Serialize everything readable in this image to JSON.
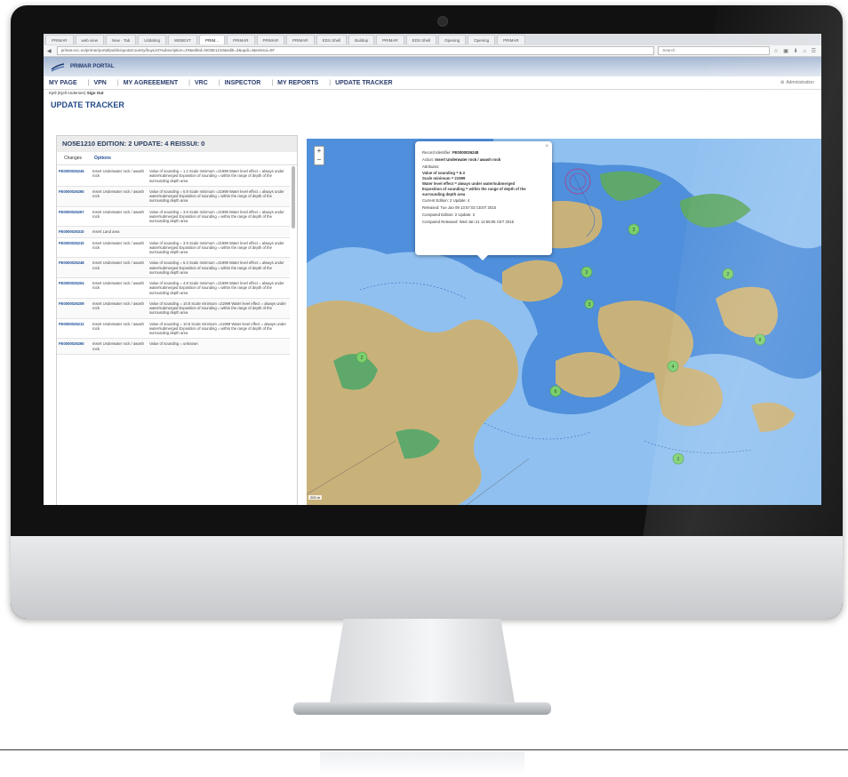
{
  "browser": {
    "tabs": [
      "PRIMAR",
      "web view",
      "New · Tab",
      "Uitdating",
      "WEBEXT",
      "PRIM...",
      "PRIMAR",
      "PRIMAR",
      "PRIMAR",
      "EDS Shell",
      "Buildup",
      "PRIMAR",
      "EDS Shell",
      "Opening",
      "Opening",
      "PRIMAR"
    ],
    "url": "primar.ecc.no/primar/portal/public/quotaCountry/buyList?subscription=2#&editId=NO5E1210&editi=2&updi=4&reissui=0#",
    "search_placeholder": "Search"
  },
  "portal": {
    "name": "PRIMAR PORTAL"
  },
  "nav": {
    "items": [
      "MY PAGE",
      "VPN",
      "MY AGREEEMENT",
      "VRC",
      "INSPECTOR",
      "MY REPORTS",
      "UPDATE TRACKER"
    ],
    "admin_label": "Administration"
  },
  "user": {
    "name": "Kjell (Kjell Andersen)",
    "signout": "Sign Out"
  },
  "page": {
    "title": "UPDATE TRACKER"
  },
  "panel": {
    "heading": "NO5E1210 EDITION: 2 UPDATE: 4 REISSUI: 0",
    "tabs": [
      "Changes",
      "Options"
    ],
    "rows": [
      {
        "id": "FE0000026245",
        "action": "Insert Underwater rock / awash rock",
        "desc": "Value of sounding = 1.2 Scale minimum =21999 Water level effect = always under water/submerged Exposition of sounding = within the range of depth of the surrounding depth area"
      },
      {
        "id": "FE0000026260",
        "action": "Insert Underwater rock / awash rock",
        "desc": "Value of sounding = 5.9 Scale minimum =21999 Water level effect = always under water/submerged Exposition of sounding = within the range of depth of the surrounding depth area"
      },
      {
        "id": "FE0000026267",
        "action": "Insert Underwater rock / awash rock",
        "desc": "Value of sounding = 3.8 Scale minimum =21999 Water level effect = always under water/submerged Exposition of sounding = within the range of depth of the surrounding depth area"
      },
      {
        "id": "FE0000026310",
        "action": "Insert Land area",
        "desc": ""
      },
      {
        "id": "FE0000026210",
        "action": "Insert Underwater rock / awash rock",
        "desc": "Value of sounding = 3.9 Scale minimum =21999 Water level effect = always under water/submerged Exposition of sounding = within the range of depth of the surrounding depth area"
      },
      {
        "id": "FE0000026248",
        "action": "Insert Underwater rock / awash rock",
        "desc": "Value of sounding = 6.3 Scale minimum =21999 Water level effect = always under water/submerged Exposition of sounding = within the range of depth of the surrounding depth area"
      },
      {
        "id": "FE0000026204",
        "action": "Insert Underwater rock / awash rock",
        "desc": "Value of sounding = 4.8 Scale minimum =21999 Water level effect = always under water/submerged Exposition of sounding = within the range of depth of the surrounding depth area"
      },
      {
        "id": "FE0000026209",
        "action": "Insert Underwater rock / awash rock",
        "desc": "Value of sounding = 10.8 Scale minimum =21999 Water level effect = always under water/submerged Exposition of sounding = within the range of depth of the surrounding depth area"
      },
      {
        "id": "FE0000026212",
        "action": "Insert Underwater rock / awash rock",
        "desc": "Value of sounding = 10.8 Scale minimum =21999 Water level effect = always under water/submerged Exposition of sounding = within the range of depth of the surrounding depth area"
      },
      {
        "id": "FE0000026260",
        "action": "Insert Underwater rock / awash rock",
        "desc": "Value of sounding = unknown"
      }
    ]
  },
  "popup": {
    "record_label": "Record Identifier:",
    "record_id": "FE0000026248",
    "action_label": "Action:",
    "action": "Insert Underwater rock / awash rock",
    "attributes_label": "Attributes:",
    "attr1": "Value of sounding = 6.3",
    "attr2": "Scale minimum = 21999",
    "attr3": "Water level effect = always under water/submerged",
    "attr4": "Exposition of sounding = within the range of depth of the surrounding depth area",
    "current": "Current Edition: 2 Update: 4",
    "released": "Released: Tue Jan 09 13:57:02 CEST 2015",
    "compared": "Compared Edition: 2 Update: 3",
    "compared_released": "Compared Released: Wed Jan 21 14:55:06 CET 2015"
  },
  "map": {
    "zoom_in": "+",
    "zoom_out": "−",
    "scale": "200 m",
    "clusters": [
      "2",
      "2",
      "2",
      "2",
      "6",
      "8",
      "4",
      "3",
      "2"
    ],
    "colors": {
      "sea": "#4f8fdb",
      "shallow": "#8fc0f0",
      "land": "#c9b27a",
      "green": "#5fa86b",
      "cluster": "#7ccf6f"
    }
  }
}
